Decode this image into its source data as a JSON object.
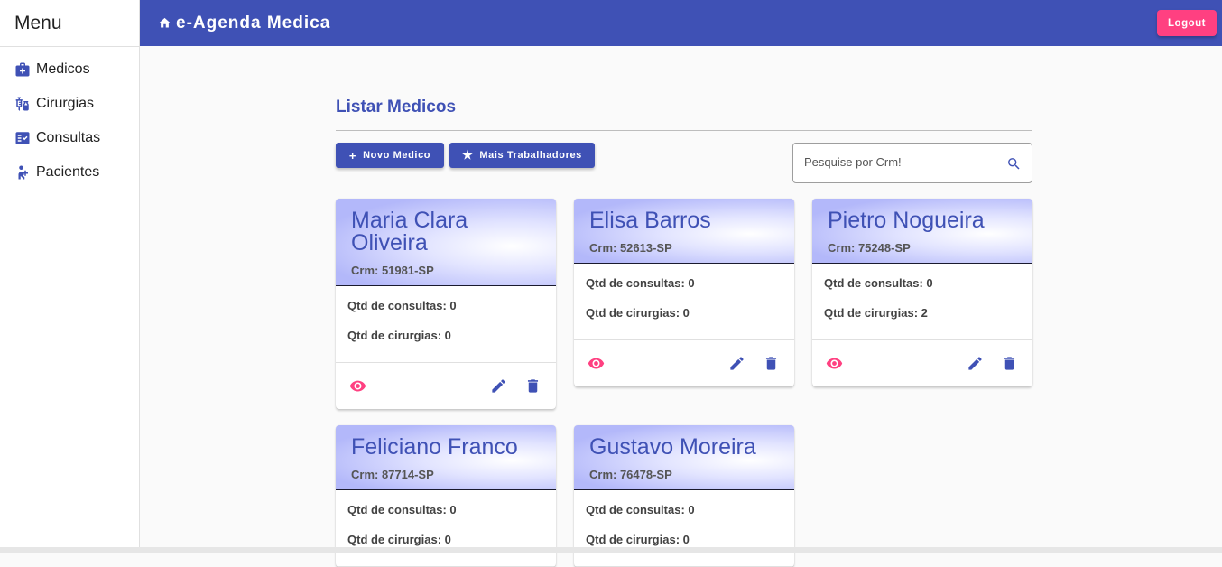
{
  "sidebar": {
    "title": "Menu",
    "items": [
      {
        "label": "Medicos",
        "icon": "medical-bag-icon"
      },
      {
        "label": "Cirurgias",
        "icon": "vaccines-icon"
      },
      {
        "label": "Consultas",
        "icon": "fact-check-icon"
      },
      {
        "label": "Pacientes",
        "icon": "patient-icon"
      }
    ]
  },
  "topbar": {
    "title": "e-Agenda Medica",
    "logout_label": "Logout"
  },
  "main": {
    "title": "Listar Medicos",
    "new_button": "Novo Medico",
    "more_button": "Mais Trabalhadores",
    "search_placeholder": "Pesquise por Crm!"
  },
  "doctors": [
    {
      "name": "Maria Clara Oliveira",
      "crm": "Crm: 51981-SP",
      "consultas": "Qtd de consultas: 0",
      "cirurgias": "Qtd de cirurgias: 0"
    },
    {
      "name": "Elisa Barros",
      "crm": "Crm: 52613-SP",
      "consultas": "Qtd de consultas: 0",
      "cirurgias": "Qtd de cirurgias: 0"
    },
    {
      "name": "Pietro Nogueira",
      "crm": "Crm: 75248-SP",
      "consultas": "Qtd de consultas: 0",
      "cirurgias": "Qtd de cirurgias: 2"
    },
    {
      "name": "Feliciano Franco",
      "crm": "Crm: 87714-SP",
      "consultas": "Qtd de consultas: 0",
      "cirurgias": "Qtd de cirurgias: 0"
    },
    {
      "name": "Gustavo Moreira",
      "crm": "Crm: 76478-SP",
      "consultas": "Qtd de consultas: 0",
      "cirurgias": "Qtd de cirurgias: 0"
    }
  ],
  "colors": {
    "primary": "#3f51b5",
    "accent": "#ff4081"
  }
}
